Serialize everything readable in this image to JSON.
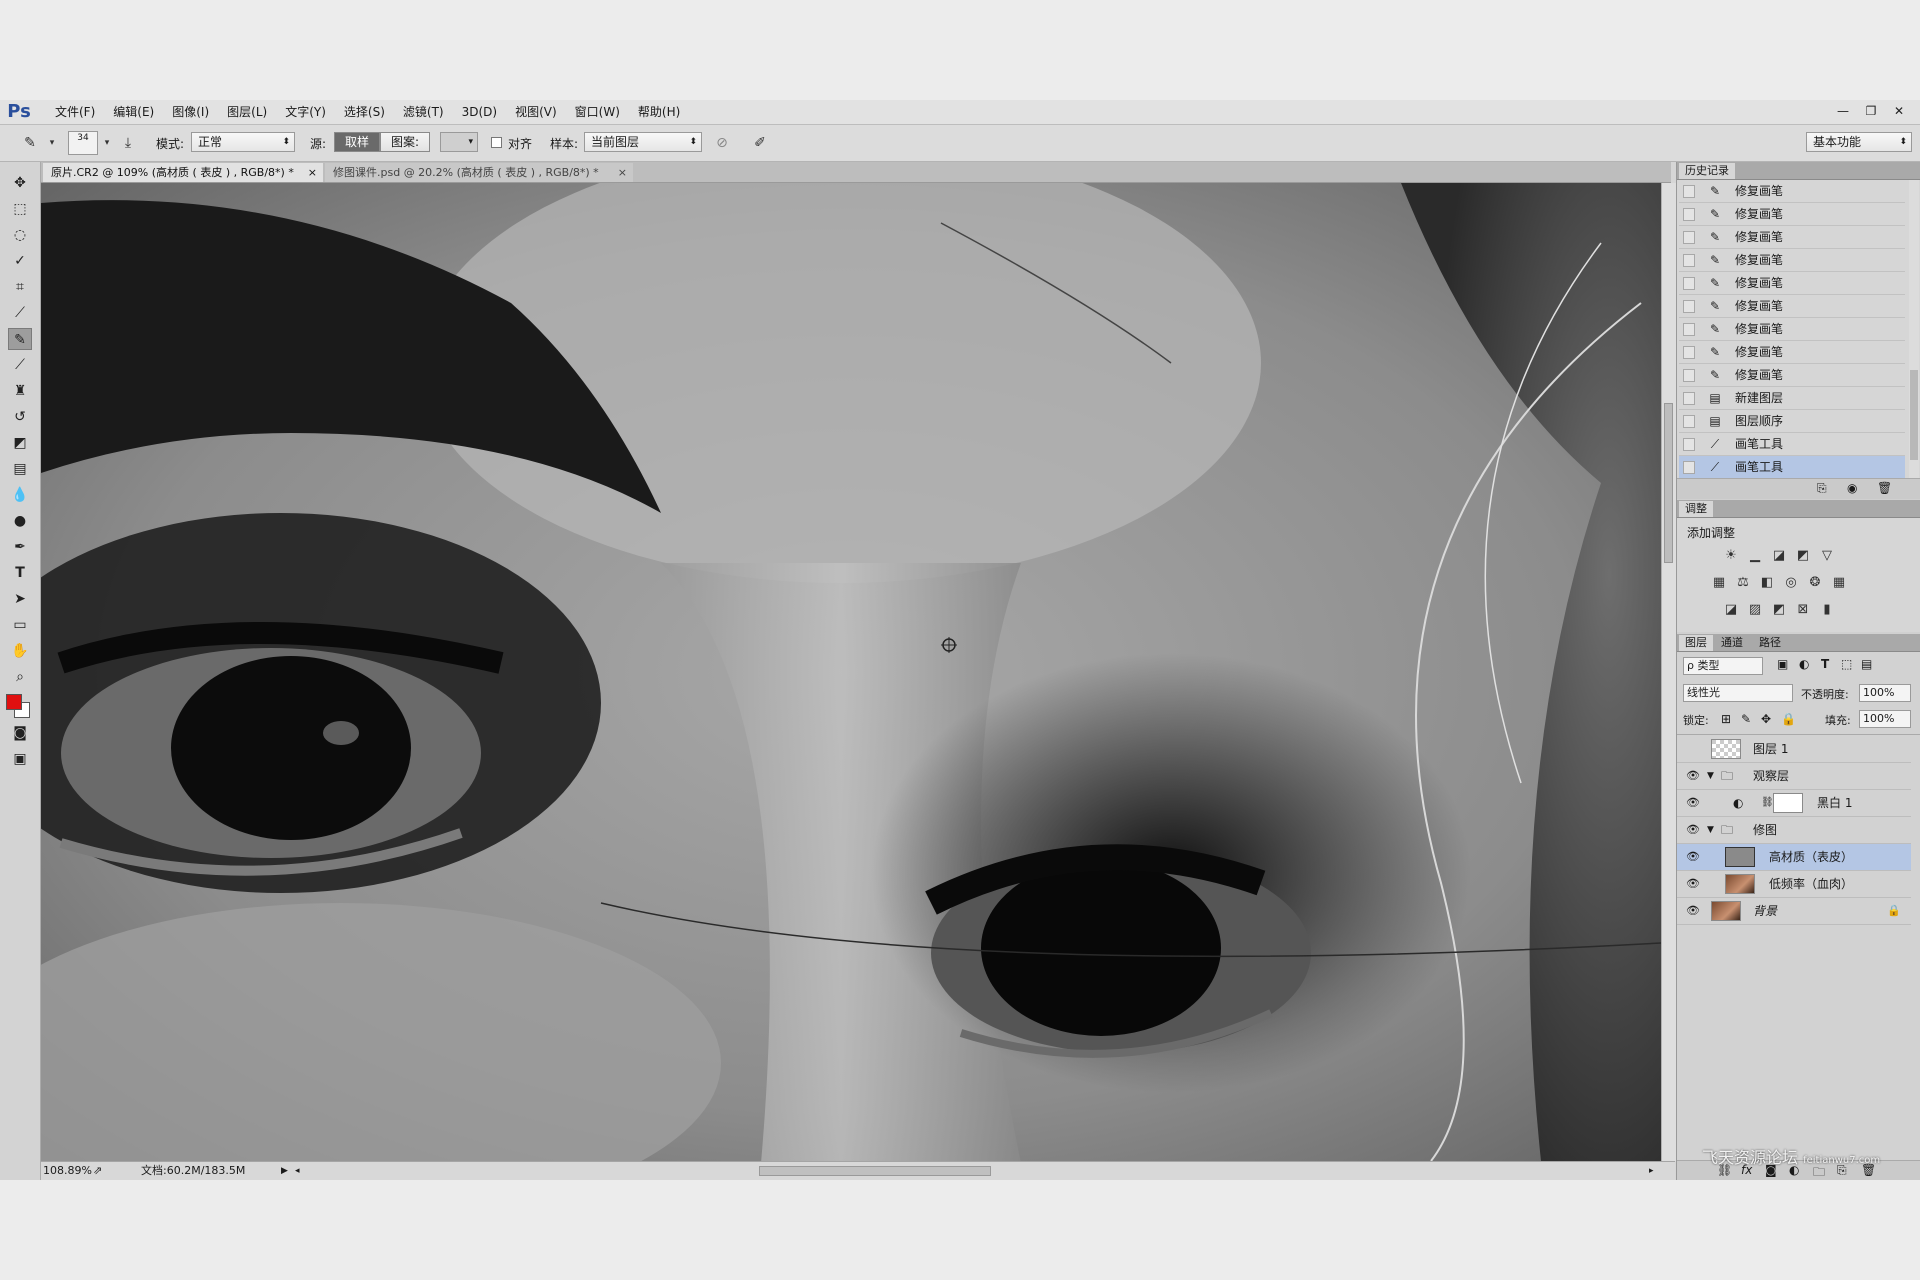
{
  "app": {
    "logo": "Ps"
  },
  "menu": [
    {
      "label": "文件(F)"
    },
    {
      "label": "编辑(E)"
    },
    {
      "label": "图像(I)"
    },
    {
      "label": "图层(L)"
    },
    {
      "label": "文字(Y)"
    },
    {
      "label": "选择(S)"
    },
    {
      "label": "滤镜(T)"
    },
    {
      "label": "3D(D)"
    },
    {
      "label": "视图(V)"
    },
    {
      "label": "窗口(W)"
    },
    {
      "label": "帮助(H)"
    }
  ],
  "window_controls": {
    "minimize": "—",
    "restore": "❐",
    "close": "✕"
  },
  "options": {
    "brush_size": "34",
    "mode_label": "模式:",
    "mode_value": "正常",
    "source_label": "源:",
    "source_sampled": "取样",
    "source_pattern": "图案:",
    "aligned_label": "对齐",
    "sample_label": "样本:",
    "sample_value": "当前图层",
    "workspace": "基本功能"
  },
  "tabs": [
    {
      "label": "原片.CR2 @ 109% (高材质 ( 表皮 ) , RGB/8*) *",
      "close": "×"
    },
    {
      "label": "修图课件.psd @ 20.2% (高材质 ( 表皮 ) , RGB/8*) *",
      "close": "×"
    }
  ],
  "status": {
    "zoom": "108.89%",
    "doc": "文档:60.2M/183.5M"
  },
  "colors": {
    "foreground": "#e01010",
    "background": "#ffffff",
    "selection": "#b4c6e4"
  },
  "history": {
    "tab": "历史记录",
    "items": [
      {
        "label": "修复画笔",
        "icon": "healing-brush-icon"
      },
      {
        "label": "修复画笔",
        "icon": "healing-brush-icon"
      },
      {
        "label": "修复画笔",
        "icon": "healing-brush-icon"
      },
      {
        "label": "修复画笔",
        "icon": "healing-brush-icon"
      },
      {
        "label": "修复画笔",
        "icon": "healing-brush-icon"
      },
      {
        "label": "修复画笔",
        "icon": "healing-brush-icon"
      },
      {
        "label": "修复画笔",
        "icon": "healing-brush-icon"
      },
      {
        "label": "修复画笔",
        "icon": "healing-brush-icon"
      },
      {
        "label": "修复画笔",
        "icon": "healing-brush-icon"
      },
      {
        "label": "新建图层",
        "icon": "layer-doc-icon"
      },
      {
        "label": "图层顺序",
        "icon": "layer-doc-icon"
      },
      {
        "label": "画笔工具",
        "icon": "brush-icon"
      },
      {
        "label": "画笔工具",
        "icon": "brush-icon"
      }
    ],
    "selected_index": 12
  },
  "adjustments": {
    "tab": "调整",
    "title": "添加调整"
  },
  "layers_panel": {
    "tabs": [
      "图层",
      "通道",
      "路径"
    ],
    "filter": "ρ 类型",
    "blend_mode": "线性光",
    "opacity_label": "不透明度:",
    "opacity_value": "100%",
    "lock_label": "锁定:",
    "fill_label": "填充:",
    "fill_value": "100%",
    "layers": [
      {
        "name": "图层 1",
        "visible": false,
        "kind": "transparent"
      },
      {
        "name": "观察层",
        "visible": true,
        "kind": "group"
      },
      {
        "name": "黑白 1",
        "visible": true,
        "kind": "adjustment"
      },
      {
        "name": "修图",
        "visible": true,
        "kind": "group"
      },
      {
        "name": "高材质（表皮）",
        "visible": true,
        "kind": "gray",
        "selected": true
      },
      {
        "name": "低频率（血肉）",
        "visible": true,
        "kind": "photo"
      },
      {
        "name": "背景",
        "visible": true,
        "kind": "photo",
        "locked": true
      }
    ]
  },
  "watermark": {
    "text": "飞天资源论坛",
    "url": "feitianwu7.com"
  }
}
